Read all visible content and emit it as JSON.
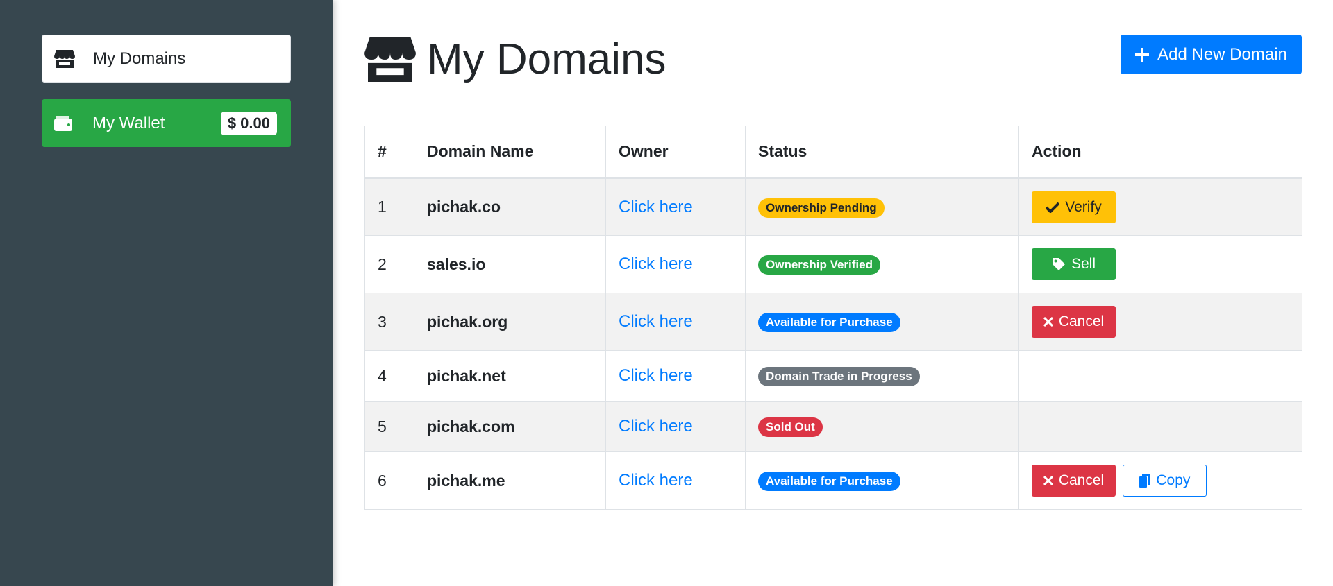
{
  "sidebar": {
    "items": [
      {
        "label": "My Domains",
        "icon": "store-icon"
      },
      {
        "label": "My Wallet",
        "icon": "wallet-icon",
        "badge": "$ 0.00"
      }
    ]
  },
  "header": {
    "title": "My Domains",
    "icon": "store-icon",
    "add_button_label": "Add New Domain"
  },
  "table": {
    "columns": [
      "#",
      "Domain Name",
      "Owner",
      "Status",
      "Action"
    ],
    "rows": [
      {
        "num": "1",
        "domain": "pichak.co",
        "owner": "Click here",
        "status": "Ownership Pending",
        "actions": [
          "Verify"
        ]
      },
      {
        "num": "2",
        "domain": "sales.io",
        "owner": "Click here",
        "status": "Ownership Verified",
        "actions": [
          "Sell"
        ]
      },
      {
        "num": "3",
        "domain": "pichak.org",
        "owner": "Click here",
        "status": "Available for Purchase",
        "actions": [
          "Cancel"
        ]
      },
      {
        "num": "4",
        "domain": "pichak.net",
        "owner": "Click here",
        "status": "Domain Trade in Progress",
        "actions": []
      },
      {
        "num": "5",
        "domain": "pichak.com",
        "owner": "Click here",
        "status": "Sold Out",
        "actions": []
      },
      {
        "num": "6",
        "domain": "pichak.me",
        "owner": "Click here",
        "status": "Available for Purchase",
        "actions": [
          "Cancel",
          "Copy"
        ]
      }
    ]
  },
  "colors": {
    "sidebar_bg": "#37474f",
    "primary": "#007bff",
    "success": "#28a745",
    "warning": "#ffc107",
    "danger": "#dc3545",
    "secondary": "#6c757d"
  }
}
